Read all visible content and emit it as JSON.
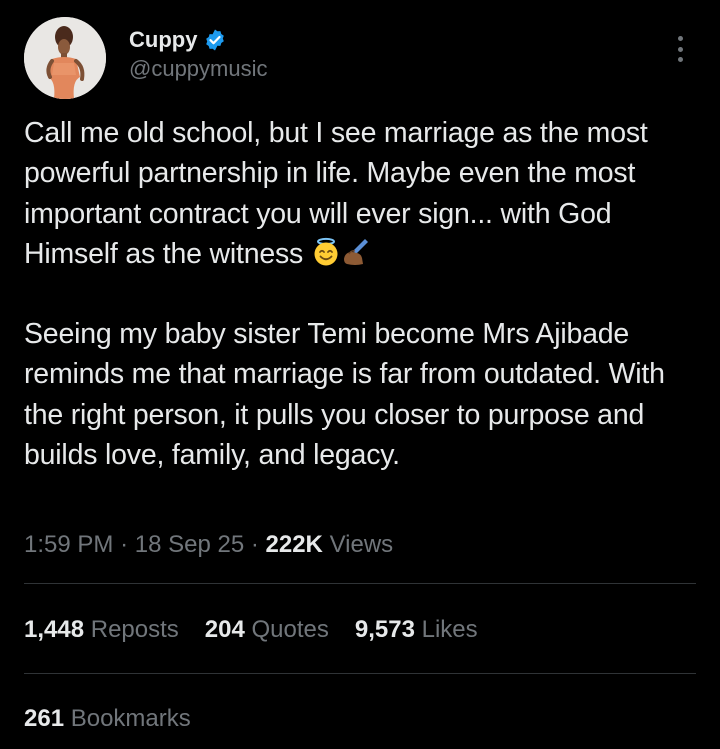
{
  "author": {
    "display_name": "Cuppy",
    "handle": "@cuppymusic",
    "verified_icon": "verified-badge-icon",
    "verified_color": "#1d9bf0"
  },
  "tweet": {
    "line1": "Call me old school, but I see marriage as the most powerful partnership in life. Maybe even the most important contract you will ever sign... with God Himself as the witness ",
    "line2": "Seeing my baby sister Temi become Mrs Ajibade reminds me that marriage is far from outdated. With the right person, it pulls you closer to purpose and builds love, family, and legacy.",
    "emojis": [
      "smiling-face-with-halo-icon",
      "writing-hand-icon"
    ]
  },
  "meta": {
    "time": "1:59 PM",
    "date": "18 Sep 25",
    "separator": "·",
    "views_count": "222K",
    "views_label": "Views"
  },
  "stats": {
    "reposts_count": "1,448",
    "reposts_label": "Reposts",
    "quotes_count": "204",
    "quotes_label": "Quotes",
    "likes_count": "9,573",
    "likes_label": "Likes",
    "bookmarks_count": "261",
    "bookmarks_label": "Bookmarks"
  },
  "colors": {
    "background": "#000000",
    "primary_text": "#e7e9ea",
    "secondary_text": "#71767b",
    "divider": "#2f3336"
  }
}
